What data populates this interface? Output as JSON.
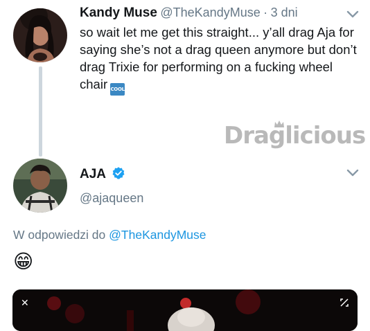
{
  "tweet1": {
    "name": "Kandy Muse",
    "handle": "@TheKandyMuse",
    "separator": "·",
    "time": "3 dni",
    "text": "so wait let me get this straight... y’all drag Aja for saying she’s not a drag queen anymore but don’t drag Trixie for performing on a fucking wheel chair",
    "emoji_icon": "cool-button-emoji",
    "emoji_label": "COOL"
  },
  "watermark": {
    "text": "Draglicious"
  },
  "tweet2": {
    "name": "AJA",
    "handle": "@ajaqueen",
    "verified_icon": "verified-badge-icon",
    "reply_prefix": "W odpowiedzi do",
    "reply_mention": "@TheKandyMuse",
    "emoji_icon": "grinning-face-emoji",
    "emoji": "😁"
  },
  "media": {
    "close_icon": "close-icon",
    "expand_icon": "expand-icon"
  },
  "colors": {
    "text": "#14171a",
    "secondary": "#657786",
    "link": "#1b95e0",
    "thread_line": "#cdd6dd",
    "verified": "#1da1f2"
  }
}
